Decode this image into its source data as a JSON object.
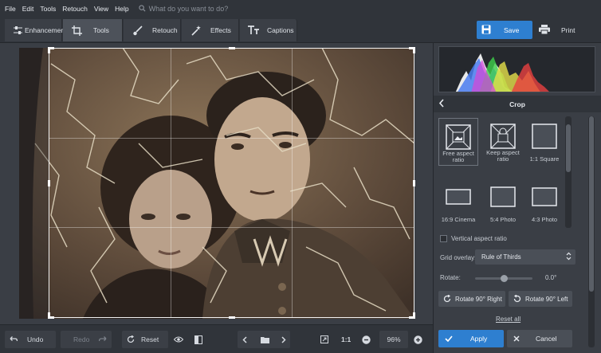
{
  "menu": {
    "items": [
      "File",
      "Edit",
      "Tools",
      "Retouch",
      "View",
      "Help"
    ],
    "search_placeholder": "What do you want to do?"
  },
  "tabs": [
    {
      "label": "Enhancement",
      "icon": "sliders-icon"
    },
    {
      "label": "Tools",
      "icon": "crop-icon",
      "active": true
    },
    {
      "label": "Retouch",
      "icon": "brush-icon"
    },
    {
      "label": "Effects",
      "icon": "magic-wand-icon"
    },
    {
      "label": "Captions",
      "icon": "text-icon"
    }
  ],
  "actions": {
    "save_label": "Save",
    "print_label": "Print"
  },
  "bottombar": {
    "undo_label": "Undo",
    "redo_label": "Redo",
    "reset_label": "Reset",
    "fit_label": "1:1",
    "zoom_value": "96%"
  },
  "panel": {
    "title": "Crop",
    "presets": [
      {
        "label": "Free aspect ratio",
        "selected": true
      },
      {
        "label": "Keep aspect ratio"
      },
      {
        "label": "1:1 Square"
      },
      {
        "label": "16:9 Cinema"
      },
      {
        "label": "5:4 Photo"
      },
      {
        "label": "4:3 Photo"
      }
    ],
    "vertical_aspect_label": "Vertical aspect ratio",
    "grid_overlay_label": "Grid overlay:",
    "grid_overlay_value": "Rule of Thirds",
    "rotate_label": "Rotate:",
    "rotate_value": "0.0°",
    "rotate_fraction": 0.5,
    "rotate_right_label": "Rotate 90° Right",
    "rotate_left_label": "Rotate 90° Left",
    "reset_all_label": "Reset all",
    "apply_label": "Apply",
    "cancel_label": "Cancel"
  },
  "colors": {
    "accent": "#2e7fd0",
    "panel_bg": "#3a3e45",
    "bar_bg": "#30343a"
  }
}
